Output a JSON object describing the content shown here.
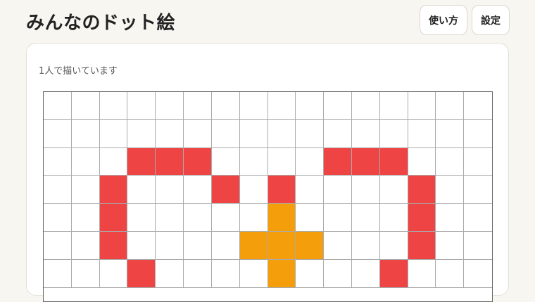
{
  "header": {
    "title": "みんなのドット絵",
    "help_label": "使い方",
    "settings_label": "設定"
  },
  "canvas": {
    "status_text": "1人で描いています",
    "columns": 16,
    "palette": {
      ".": "#ffffff",
      "R": "#ef4444",
      "O": "#f59e0b"
    },
    "rows": [
      "................",
      "................",
      "...RRR....RRR...",
      "..R...R.R....R..",
      "..R.....O....R..",
      "..R....OOO...R..",
      "...R....O...R..."
    ]
  }
}
